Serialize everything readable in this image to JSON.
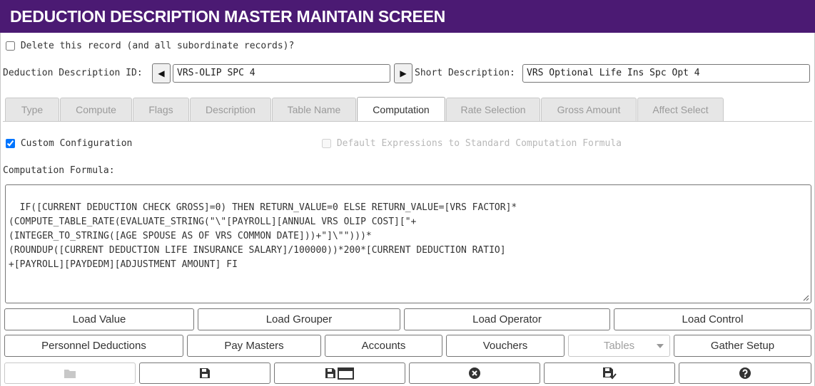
{
  "title": "DEDUCTION DESCRIPTION MASTER MAINTAIN SCREEN",
  "delete_record": {
    "label": "Delete this record (and all subordinate records)?",
    "checked": false
  },
  "id_field": {
    "label": "Deduction Description ID:",
    "value": "VRS-OLIP SPC 4"
  },
  "short_desc": {
    "label": "Short Description:",
    "value": "VRS Optional Life Ins Spc Opt 4"
  },
  "tabs": [
    {
      "label": "Type",
      "active": false
    },
    {
      "label": "Compute",
      "active": false
    },
    {
      "label": "Flags",
      "active": false
    },
    {
      "label": "Description",
      "active": false
    },
    {
      "label": "Table Name",
      "active": false
    },
    {
      "label": "Computation",
      "active": true
    },
    {
      "label": "Rate Selection",
      "active": false
    },
    {
      "label": "Gross Amount",
      "active": false
    },
    {
      "label": "Affect Select",
      "active": false
    }
  ],
  "custom_config": {
    "label": "Custom Configuration",
    "checked": true
  },
  "default_expr": {
    "label": "Default Expressions to Standard Computation Formula",
    "checked": false,
    "disabled": true
  },
  "formula_label": "Computation Formula:",
  "formula": "IF([CURRENT DEDUCTION CHECK GROSS]=0) THEN RETURN_VALUE=0 ELSE RETURN_VALUE=[VRS FACTOR]*\n(COMPUTE_TABLE_RATE(EVALUATE_STRING(\"\\\"[PAYROLL][ANNUAL VRS OLIP COST][\"+\n(INTEGER_TO_STRING([AGE SPOUSE AS OF VRS COMMON DATE]))+\"]\\\"\")))*\n(ROUNDUP([CURRENT DEDUCTION LIFE INSURANCE SALARY]/100000))*200*[CURRENT DEDUCTION RATIO]\n+[PAYROLL][PAYDEDM][ADJUSTMENT AMOUNT] FI",
  "load_buttons": {
    "load_value": "Load Value",
    "load_grouper": "Load Grouper",
    "load_operator": "Load Operator",
    "load_control": "Load Control"
  },
  "nav_buttons": {
    "personnel_deductions": "Personnel Deductions",
    "pay_masters": "Pay Masters",
    "accounts": "Accounts",
    "vouchers": "Vouchers",
    "tables": "Tables",
    "gather_setup": "Gather Setup"
  },
  "toolbar_icons": [
    "folder-icon",
    "save-icon",
    "save-window-icon",
    "close-circle-icon",
    "save-check-icon",
    "help-icon"
  ],
  "colors": {
    "title_bg": "#4b1a73",
    "title_text": "#ffffff"
  }
}
